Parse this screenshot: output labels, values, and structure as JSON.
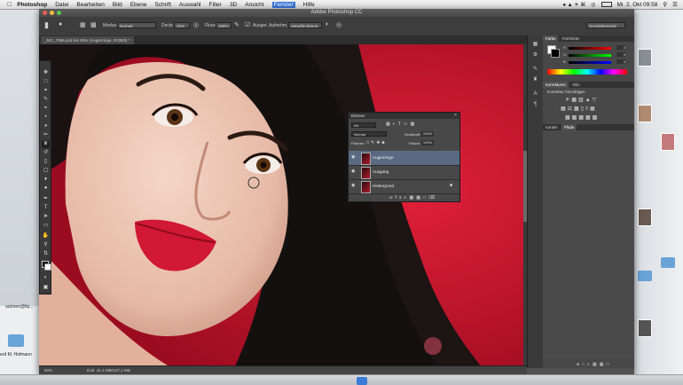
{
  "menubar": {
    "app": "Photoshop",
    "items": [
      "Datei",
      "Bearbeiten",
      "Bild",
      "Ebene",
      "Schrift",
      "Auswahl",
      "Filter",
      "3D",
      "Ansicht",
      "Fenster",
      "Hilfe"
    ],
    "highlighted": "Fenster",
    "clock": "Mi. 2. Okt 09:58"
  },
  "window": {
    "title": "Adobe Photoshop CC",
    "doc_tab": "_MG_7066.psd bei 50% (Augenringe, RGB/8) *"
  },
  "options": {
    "mode_label": "Modus:",
    "mode_value": "Normal",
    "opacity_label": "Deckr.:",
    "opacity_value": "25%",
    "flow_label": "Fluss:",
    "flow_value": "100%",
    "aligned_label": "Ausger.",
    "sample_label": "Aufnehm.:",
    "sample_value": "Aktuelle Ebene",
    "workspace": "Grundelemente"
  },
  "statusbar": {
    "zoom": "50%",
    "doc": "Dok: 41,4 MB/137,1 MB"
  },
  "color_panel": {
    "tabs": [
      "Farbe",
      "Farbfelder"
    ],
    "rows": [
      {
        "label": "R",
        "value": "0"
      },
      {
        "label": "G",
        "value": "0"
      },
      {
        "label": "B",
        "value": "0"
      }
    ]
  },
  "adjust_panel": {
    "tabs": [
      "Korrekturen",
      "Stile"
    ],
    "title": "Korrektur hinzufügen"
  },
  "libs_panel": {
    "tabs": [
      "Kanäle",
      "Pfade"
    ]
  },
  "layers": {
    "tab": "Ebenen",
    "kind_value": "Art",
    "blend_value": "Normal",
    "opacity_label": "Deckkraft:",
    "opacity_value": "100%",
    "lock_label": "Fixieren:",
    "fill_label": "Fläche:",
    "fill_value": "100%",
    "rows": [
      {
        "name": "Augenringe",
        "selected": true
      },
      {
        "name": "Ausgang",
        "selected": false
      },
      {
        "name": "Hintergrund",
        "selected": false
      }
    ]
  },
  "desktop": {
    "left_labels": [
      "autoren@fip...",
      "erd M. Hofmann"
    ]
  }
}
